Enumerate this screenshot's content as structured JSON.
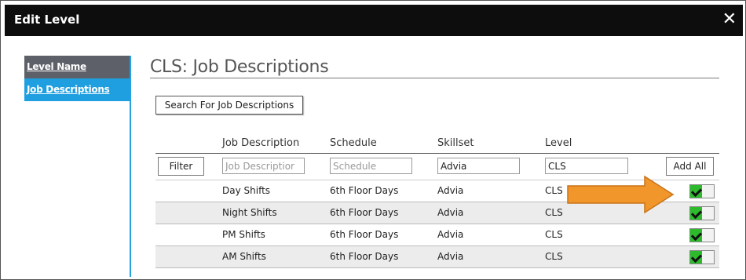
{
  "window": {
    "title": "Edit Level",
    "close_glyph": "✕"
  },
  "sidebar": {
    "items": [
      {
        "label": "Level Name"
      },
      {
        "label": "Job Descriptions"
      }
    ]
  },
  "main": {
    "heading": "CLS: Job Descriptions",
    "search_button": "Search For Job Descriptions",
    "columns": [
      "Job Description",
      "Schedule",
      "Skillset",
      "Level"
    ],
    "filters": {
      "filter_button": "Filter",
      "job_description": {
        "value": "",
        "placeholder": "Job Descriptior"
      },
      "schedule": {
        "value": "",
        "placeholder": "Schedule"
      },
      "skillset": {
        "value": "Advia",
        "placeholder": ""
      },
      "level": {
        "value": "CLS",
        "placeholder": ""
      },
      "add_all_button": "Add All"
    },
    "rows": [
      {
        "job_description": "Day Shifts",
        "schedule": "6th Floor Days",
        "skillset": "Advia",
        "level": "CLS",
        "selected": true
      },
      {
        "job_description": "Night Shifts",
        "schedule": "6th Floor Days",
        "skillset": "Advia",
        "level": "CLS",
        "selected": true
      },
      {
        "job_description": "PM Shifts",
        "schedule": "6th Floor Days",
        "skillset": "Advia",
        "level": "CLS",
        "selected": true
      },
      {
        "job_description": "AM Shifts",
        "schedule": "6th Floor Days",
        "skillset": "Advia",
        "level": "CLS",
        "selected": true
      }
    ]
  },
  "colors": {
    "titlebar": "#0d0d0d",
    "sidebar_level_name": "#5d6068",
    "sidebar_active": "#1f9fe0",
    "toggle_on": "#2dbb2d",
    "annotation_arrow": "#f0962a"
  },
  "icons": {
    "close": "close-icon",
    "toggle": "checkmark-icon",
    "annotation": "arrow-right-icon"
  }
}
